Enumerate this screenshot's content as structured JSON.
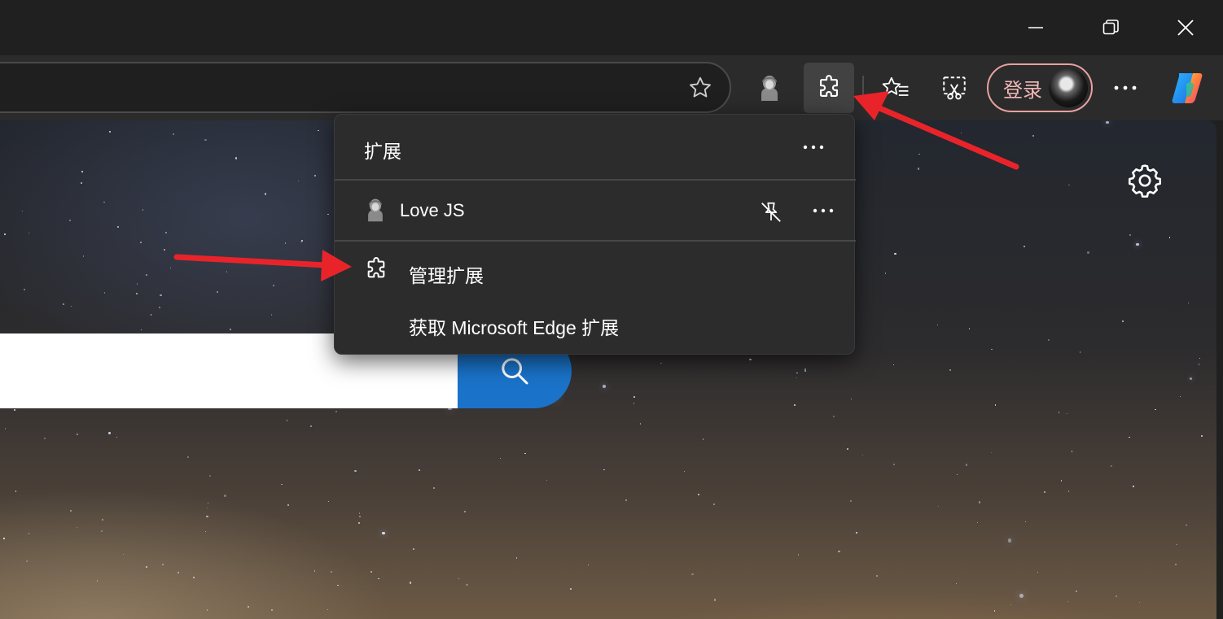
{
  "window": {
    "controls": [
      "minimize",
      "restore",
      "close"
    ]
  },
  "toolbar": {
    "signin_label": "登录",
    "icons": [
      "favorite-star-icon",
      "love-js-extension-icon",
      "extensions-puzzle-icon",
      "favorites-icon",
      "screenshot-icon",
      "more-icon",
      "copilot-icon"
    ]
  },
  "extensions_menu": {
    "title": "扩展",
    "extensions": [
      {
        "name": "Love JS"
      }
    ],
    "manage_label": "管理扩展",
    "get_label": "获取 Microsoft Edge 扩展"
  },
  "colors": {
    "accent_search": "#1a73c9",
    "annotation_arrow": "#e8242a",
    "signin_border": "#e8a0a0"
  }
}
